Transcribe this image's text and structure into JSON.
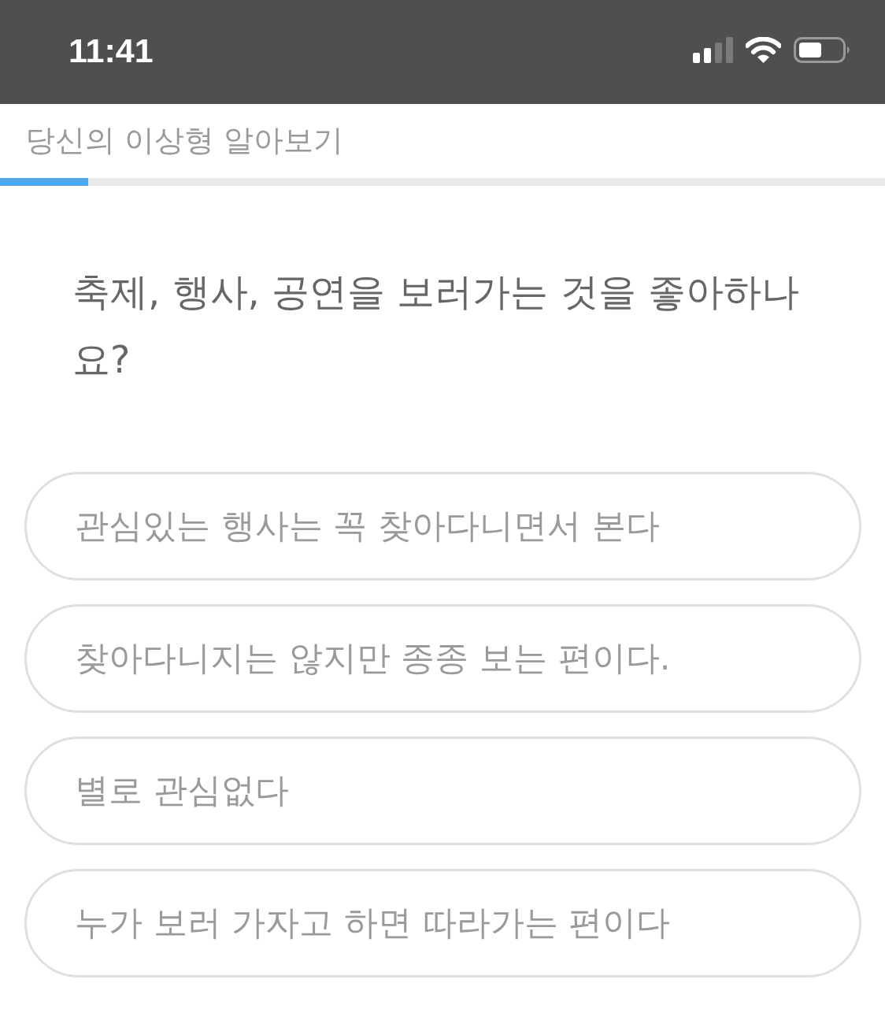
{
  "status_bar": {
    "time": "11:41"
  },
  "header": {
    "title": "당신의 이상형 알아보기"
  },
  "progress": {
    "level": 0.1
  },
  "question": {
    "text": "축제, 행사, 공연을 보러가는 것을 좋아하나요?"
  },
  "options": [
    {
      "label": "관심있는 행사는 꼭 찾아다니면서 본다",
      "selected": false
    },
    {
      "label": "찾아다니지는 않지만 종종 보는 편이다.",
      "selected": false
    },
    {
      "label": "별로 관심없다",
      "selected": false
    },
    {
      "label": "누가 보러 가자고 하면 따라가는 편이다",
      "selected": false
    }
  ]
}
